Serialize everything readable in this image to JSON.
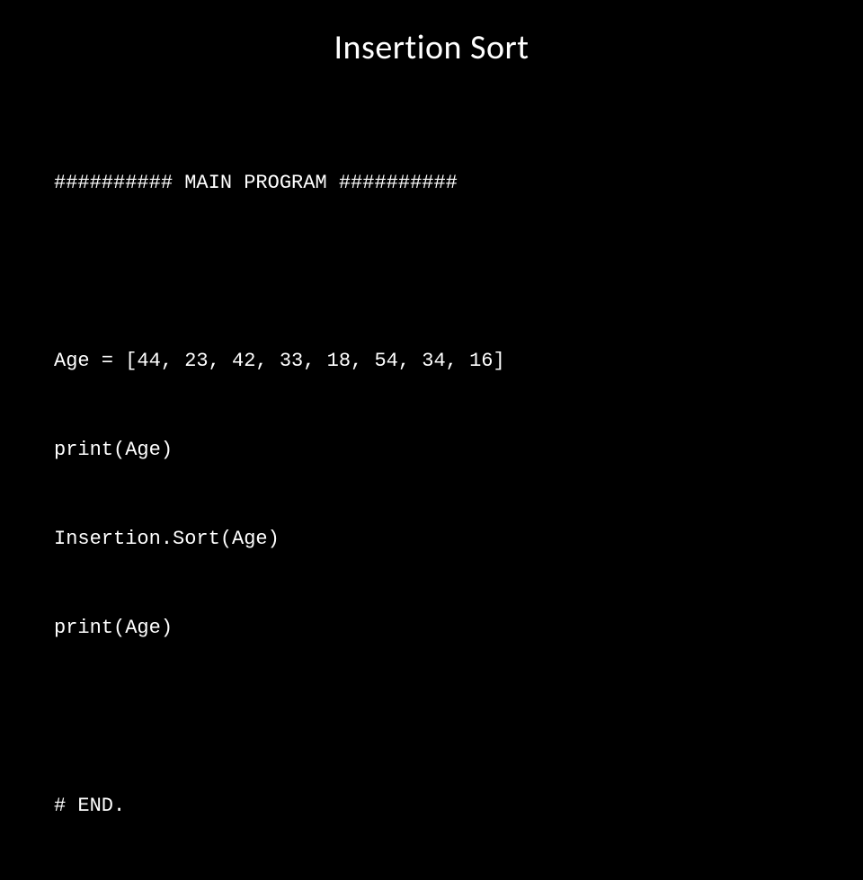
{
  "title": "Insertion Sort",
  "code": {
    "line1": "########## MAIN PROGRAM ##########",
    "line2": "Age = [44, 23, 42, 33, 18, 54, 34, 16]",
    "line3": "print(Age)",
    "line4": "Insertion.Sort(Age)",
    "line5": "print(Age)",
    "line6": "# END."
  }
}
